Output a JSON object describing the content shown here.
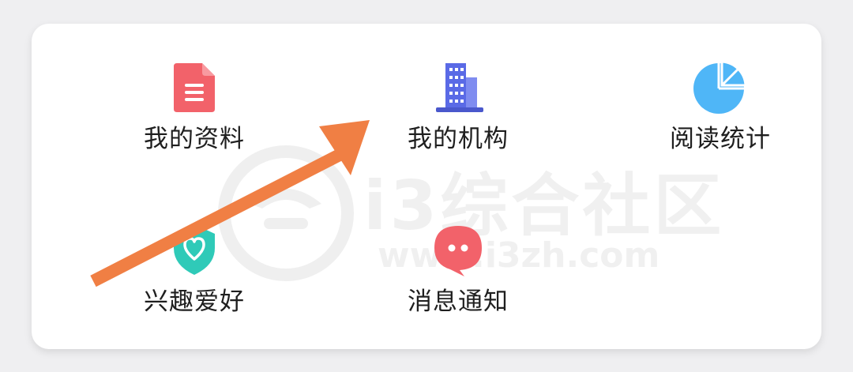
{
  "menu": {
    "items": [
      {
        "label": "我的资料",
        "icon": "document-icon",
        "color": "#f2626a"
      },
      {
        "label": "我的机构",
        "icon": "building-icon",
        "color": "#5a6ae6"
      },
      {
        "label": "阅读统计",
        "icon": "pie-chart-icon",
        "color": "#4fb6f7"
      },
      {
        "label": "兴趣爱好",
        "icon": "shield-heart-icon",
        "color": "#2fcab8"
      },
      {
        "label": "消息通知",
        "icon": "chat-bubble-icon",
        "color": "#f2626a"
      }
    ]
  },
  "watermark": {
    "name": "i3综合社区",
    "url": "www.i3zh.com"
  },
  "annotation": {
    "arrow_color": "#f07f44"
  }
}
